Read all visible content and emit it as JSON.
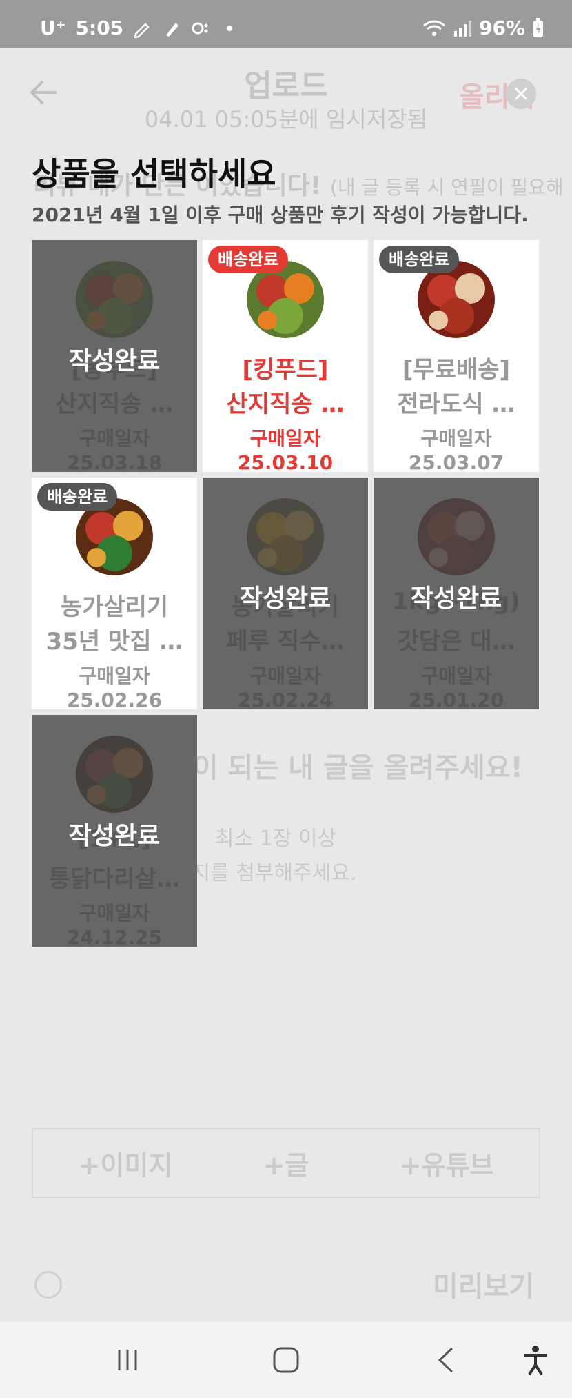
{
  "status_bar": {
    "carrier": "U⁺",
    "time": "5:05",
    "battery": "96%",
    "icons": [
      "pencil-icon",
      "pen-icon",
      "link-icon",
      "dot-icon",
      "wifi-icon",
      "signal-icon",
      "battery-icon"
    ]
  },
  "background_page": {
    "title": "업로드",
    "draft_saved": "04.01 05:05분에 임시저장됨",
    "upload_label": "올리기",
    "notice": "리뷰 내가 만든 어있습니다!",
    "notice_small": "(내 글 등록 시 연필이 필요해",
    "prompt": "이 되는 내 글을 올려주세요!",
    "min_line1": "최소 1장 이상",
    "min_line2": "미지를 첨부해주세요.",
    "tools": [
      "+이미지",
      "+글",
      "+유튜브"
    ],
    "preview_label": "미리보기"
  },
  "modal": {
    "title": "상품을 선택하세요",
    "subtitle": "2021년 4월 1일 이후 구매 상품만 후기 작성이 가능합니다.",
    "date_label": "구매일자",
    "done_label": "작성완료",
    "products": [
      {
        "brand": "[농부드]",
        "name": "산지직송 …",
        "date": "25.03.18",
        "badge": "",
        "written": true,
        "highlight": false,
        "thumb": "tomato"
      },
      {
        "brand": "[킹푸드]",
        "name": "산지직송 …",
        "date": "25.03.10",
        "badge": "배송완료",
        "written": false,
        "highlight": true,
        "thumb": "tomato"
      },
      {
        "brand": "[무료배송]",
        "name": "전라도식 …",
        "date": "25.03.07",
        "badge": "배송완료",
        "written": false,
        "highlight": false,
        "thumb": "kimchi"
      },
      {
        "brand": "농가살리기",
        "name": "35년 맛집 …",
        "date": "25.02.26",
        "badge": "배송완료",
        "written": false,
        "highlight": false,
        "thumb": "stew"
      },
      {
        "brand": "농가살리기",
        "name": "페루 직수…",
        "date": "25.02.24",
        "badge": "",
        "written": true,
        "highlight": false,
        "thumb": "mango"
      },
      {
        "brand": "1kg+1kg)",
        "name": "갓담은 대…",
        "date": "25.01.20",
        "badge": "",
        "written": true,
        "highlight": false,
        "thumb": "kimchi2"
      },
      {
        "brand": "[1+1]",
        "name": "통닭다리살…",
        "date": "24.12.25",
        "badge": "",
        "written": true,
        "highlight": false,
        "thumb": "chicken"
      }
    ]
  },
  "colors": {
    "accent": "#e23b35",
    "overlay": "#464646",
    "badge_dark": "#555555"
  }
}
